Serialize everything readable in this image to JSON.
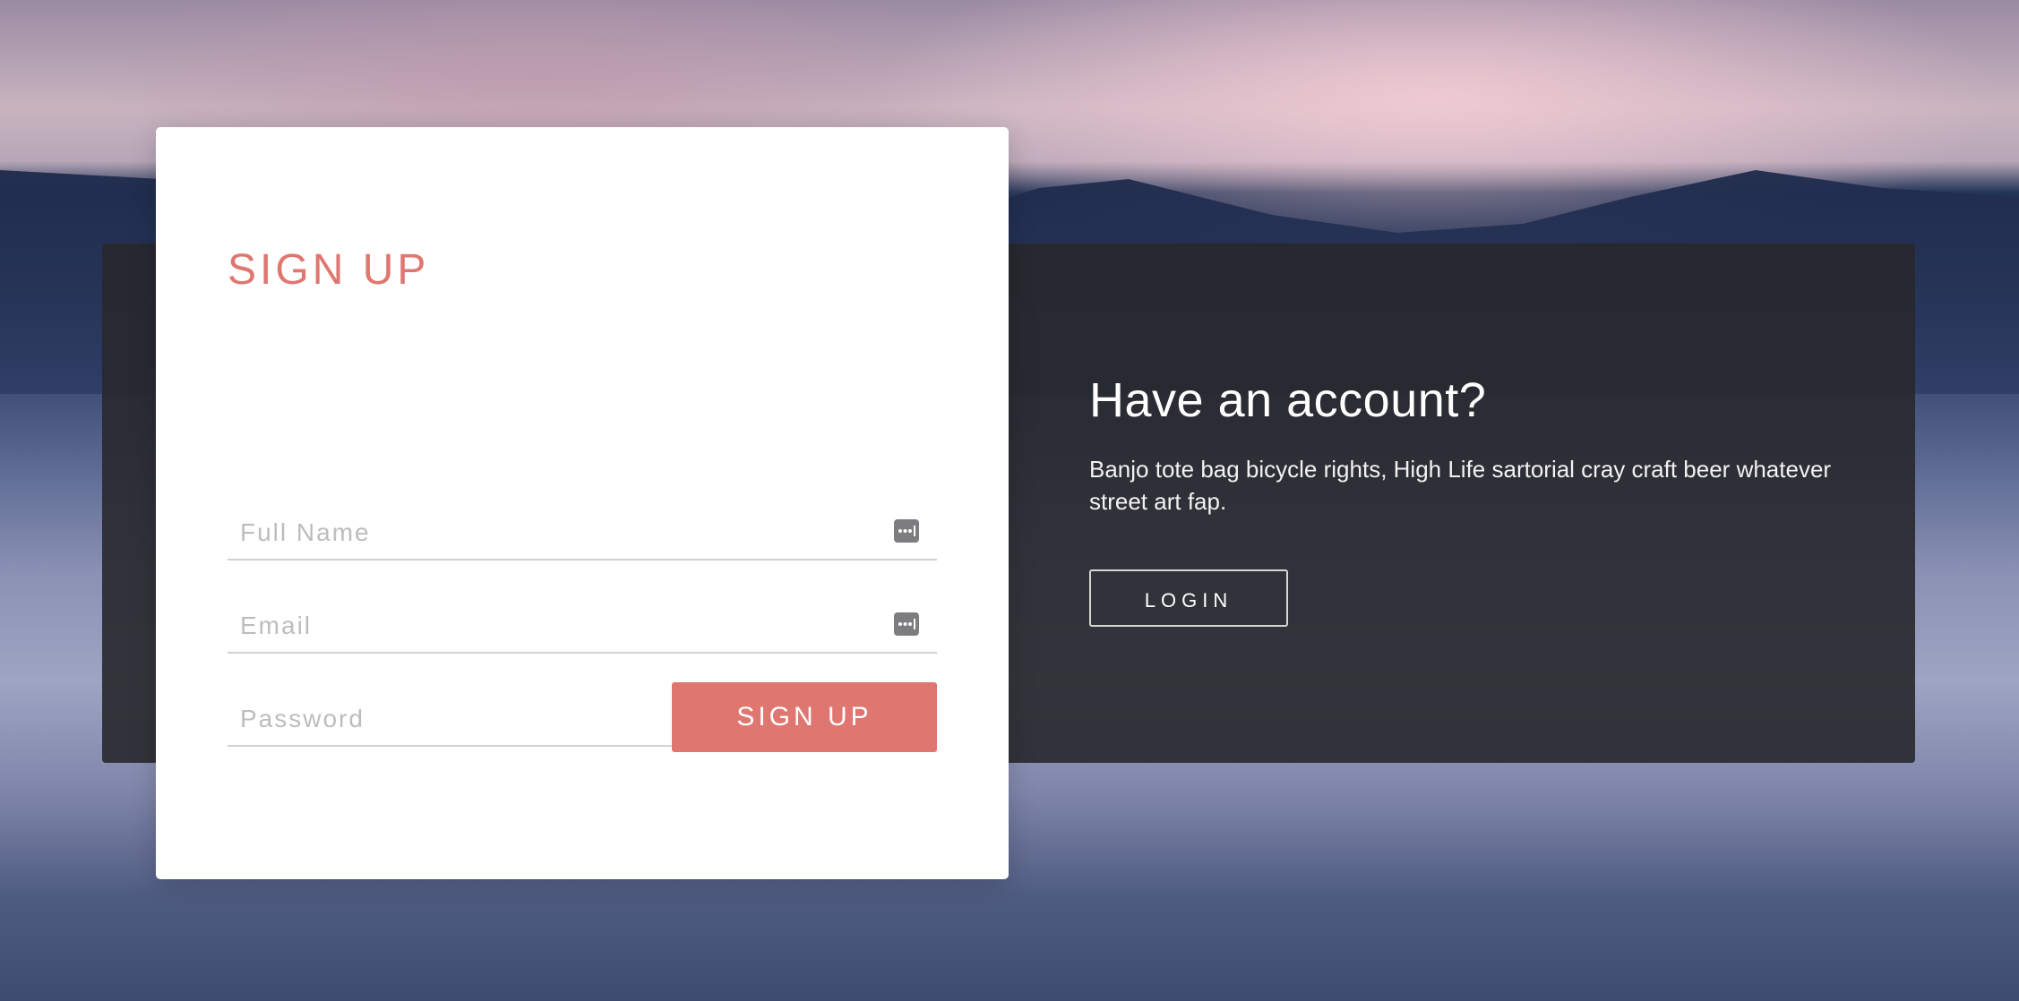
{
  "signup": {
    "title": "SIGN UP",
    "fields": [
      {
        "placeholder": "Full Name",
        "value": "",
        "icon": "password-manager-icon"
      },
      {
        "placeholder": "Email",
        "value": "",
        "icon": "password-manager-icon"
      },
      {
        "placeholder": "Password",
        "value": "",
        "icon": "password-manager-icon"
      }
    ],
    "button_label": "SIGN UP"
  },
  "login": {
    "heading": "Have an account?",
    "text": "Banjo tote bag bicycle rights, High Life sartorial cray craft beer whatever street art fap.",
    "button_label": "LOGIN"
  },
  "colors": {
    "accent": "#df7770",
    "panel": "#28282c",
    "card": "#ffffff"
  }
}
